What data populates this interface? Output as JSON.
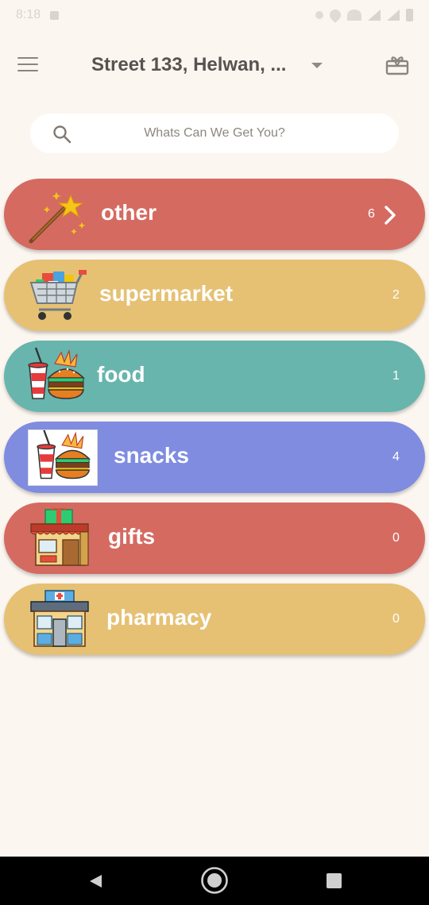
{
  "status_bar": {
    "time": "8:18"
  },
  "header": {
    "address": "Street 133, Helwan, ..."
  },
  "search": {
    "placeholder": "Whats Can We Get You?"
  },
  "categories": [
    {
      "label": "other",
      "count": "6",
      "color": "#d56a61",
      "icon": "magic-wand-icon"
    },
    {
      "label": "supermarket",
      "count": "2",
      "color": "#e6c174",
      "icon": "shopping-cart-icon"
    },
    {
      "label": "food",
      "count": "1",
      "color": "#68b5ad",
      "icon": "fast-food-icon"
    },
    {
      "label": "snacks",
      "count": "4",
      "color": "#7f8ce0",
      "icon": "fast-food-icon"
    },
    {
      "label": "gifts",
      "count": "0",
      "color": "#d56a61",
      "icon": "gift-shop-icon"
    },
    {
      "label": "pharmacy",
      "count": "0",
      "color": "#e6c174",
      "icon": "pharmacy-icon"
    }
  ],
  "nav_bar": {
    "background": "#000000"
  }
}
